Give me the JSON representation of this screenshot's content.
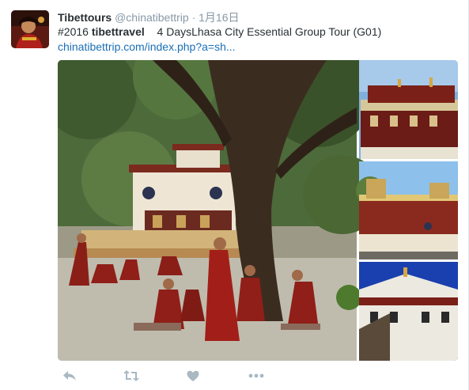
{
  "tweet": {
    "author_name": "Tibettours",
    "handle": "@chinatibettrip",
    "separator": "·",
    "timestamp": "1月16日",
    "hashtag1": "#2016",
    "hashtag2": "tibettravel",
    "text": "4 DaysLhasa City Essential Group Tour (G01)",
    "link": "chinatibettrip.com/index.php?a=sh..."
  },
  "actions": [
    {
      "icon": "reply-icon"
    },
    {
      "icon": "retweet-icon"
    },
    {
      "icon": "like-icon"
    },
    {
      "icon": "more-icon"
    }
  ],
  "colors": {
    "link": "#1b6fb5",
    "muted": "#8899a6",
    "action": "#aab8c2",
    "text": "#292f33"
  }
}
